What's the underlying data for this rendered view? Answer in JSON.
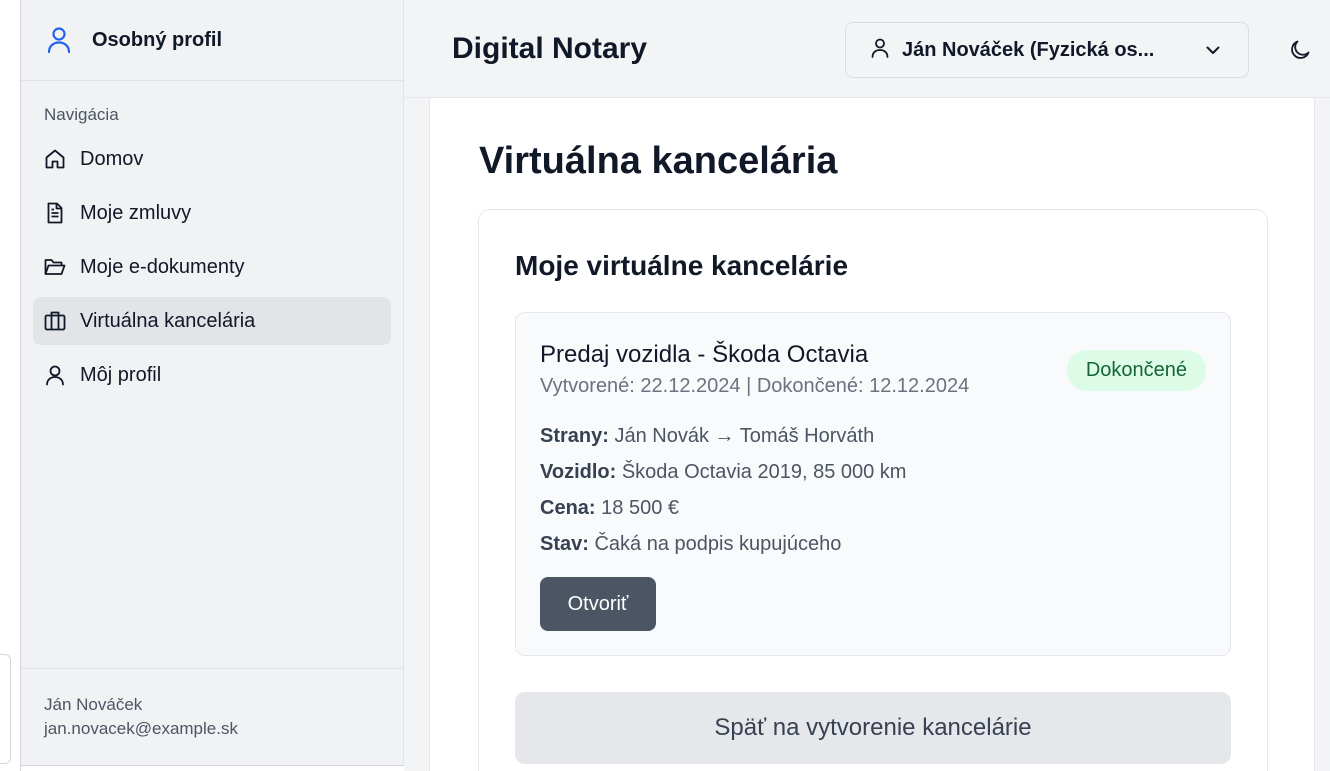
{
  "sidebar": {
    "header_title": "Osobný profil",
    "nav_heading": "Navigácia",
    "items": [
      {
        "label": "Domov",
        "icon": "home-icon"
      },
      {
        "label": "Moje zmluvy",
        "icon": "document-icon"
      },
      {
        "label": "Moje e-dokumenty",
        "icon": "folder-icon"
      },
      {
        "label": "Virtuálna kancelária",
        "icon": "briefcase-icon",
        "active": true
      },
      {
        "label": "Môj profil",
        "icon": "user-icon"
      }
    ],
    "footer": {
      "name": "Ján Nováček",
      "email": "jan.novacek@example.sk"
    }
  },
  "topbar": {
    "app_title": "Digital Notary",
    "user_select": "Ján Nováček (Fyzická os..."
  },
  "main": {
    "page_title": "Virtuálna kancelária",
    "panel_title": "Moje virtuálne kancelárie",
    "office": {
      "name": "Predaj vozidla - Škoda Octavia",
      "dates": "Vytvorené: 22.12.2024 | Dokončené: 12.12.2024",
      "status_badge": "Dokončené",
      "details": [
        {
          "label": "Strany:",
          "value": "Ján Novák → Tomáš Horváth"
        },
        {
          "label": "Vozidlo:",
          "value": "Škoda Octavia 2019, 85 000 km"
        },
        {
          "label": "Cena:",
          "value": "18 500 €"
        },
        {
          "label": "Stav:",
          "value": "Čaká na podpis kupujúceho"
        }
      ],
      "open_button": "Otvoriť"
    },
    "back_button": "Späť na vytvorenie kancelárie"
  },
  "colors": {
    "accent_blue": "#2563eb",
    "badge_bg": "#dcfce7",
    "badge_text": "#166534",
    "primary_button": "#4b5563"
  }
}
